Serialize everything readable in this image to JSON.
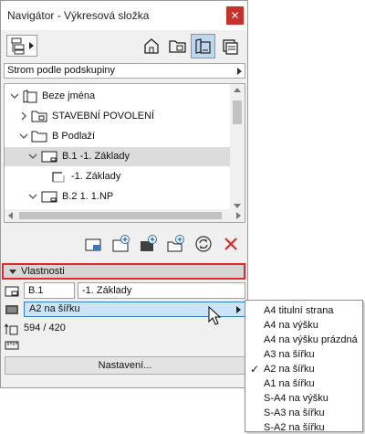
{
  "window": {
    "title": "Navigátor - Výkresová složka",
    "close_symbol": "✕"
  },
  "toolbar": {
    "popup_icon": "project-map-popup-icon",
    "view_buttons": [
      {
        "name": "project-map",
        "icon": "house-icon",
        "active": false
      },
      {
        "name": "view-map",
        "icon": "folder-icon",
        "active": false
      },
      {
        "name": "layout-book",
        "icon": "layout-book-icon",
        "active": true
      },
      {
        "name": "publisher-sets",
        "icon": "publisher-icon",
        "active": false
      }
    ]
  },
  "subset_selector": {
    "label": "Strom podle podskupiny"
  },
  "tree": {
    "items": [
      {
        "label": "Beze jména",
        "expander": "expanded",
        "icon": "book-icon",
        "selected": false
      },
      {
        "label": "STAVEBNÍ POVOLENÍ",
        "expander": "collapsed",
        "icon": "folder-icon",
        "selected": false
      },
      {
        "label": "B Podlaží",
        "expander": "expanded",
        "icon": "folder-icon",
        "selected": false
      },
      {
        "label": "B.1 -1. Základy",
        "expander": "expanded",
        "icon": "layout-icon",
        "selected": true
      },
      {
        "label": "-1. Základy",
        "expander": "none",
        "icon": "drawing-icon",
        "selected": false
      },
      {
        "label": "B.2 1. 1.NP",
        "expander": "expanded",
        "icon": "layout-icon",
        "selected": false
      }
    ]
  },
  "actions": [
    {
      "name": "new-master-layout",
      "icon": "master-layout-icon"
    },
    {
      "name": "new-layout",
      "icon": "new-layout-icon"
    },
    {
      "name": "new-subset",
      "icon": "new-subset-icon"
    },
    {
      "name": "new-folder",
      "icon": "new-folder-icon"
    },
    {
      "name": "update",
      "icon": "refresh-icon"
    },
    {
      "name": "delete",
      "icon": "delete-icon",
      "color": "#e0262f"
    }
  ],
  "properties": {
    "header": "Vlastnosti",
    "id_value": "B.1",
    "name_value": "-1. Základy",
    "size_selected": "A2 na šířku",
    "dimensions": "594 / 420",
    "settings_label": "Nastavení..."
  },
  "size_menu": {
    "items": [
      {
        "label": "A4 titulní strana",
        "checked": false
      },
      {
        "label": "A4 na výšku",
        "checked": false
      },
      {
        "label": "A4 na výšku prázdná",
        "checked": false
      },
      {
        "label": "A3 na šířku",
        "checked": false
      },
      {
        "label": "A2 na šířku",
        "checked": true
      },
      {
        "label": "A1 na šířku",
        "checked": false
      },
      {
        "label": "S-A4 na výšku",
        "checked": false
      },
      {
        "label": "S-A3 na šířku",
        "checked": false
      },
      {
        "label": "S-A2 na šířku",
        "checked": false
      }
    ],
    "check_symbol": "✓"
  },
  "colors": {
    "highlight_border": "#e0262f",
    "active_button": "#bcd7ee",
    "selected_dropdown": "#cce4f7"
  }
}
